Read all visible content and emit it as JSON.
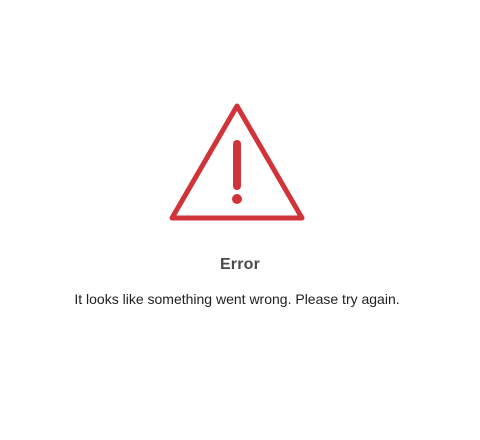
{
  "error": {
    "icon": "warning-triangle-icon",
    "icon_color": "#d0343a",
    "title": "Error",
    "message": "It looks like something went wrong. Please try again."
  }
}
